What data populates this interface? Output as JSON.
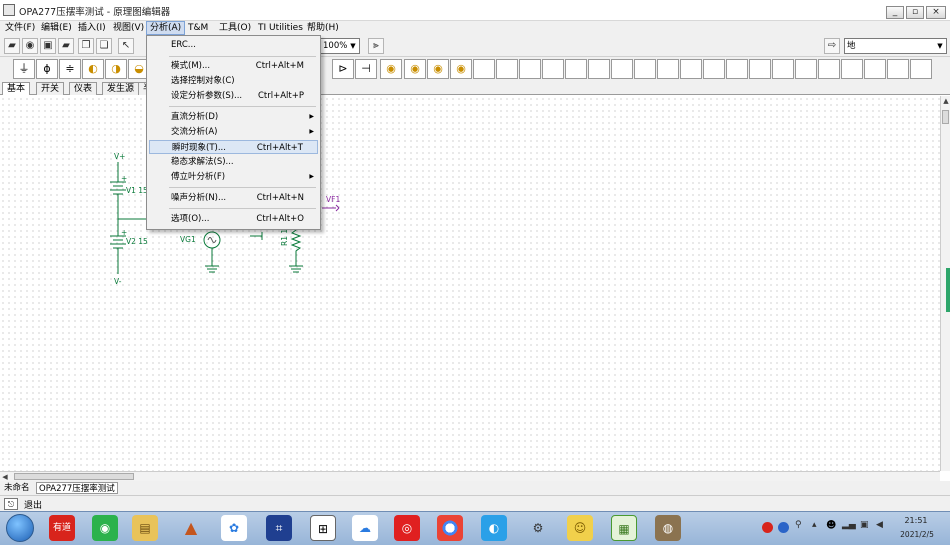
{
  "window": {
    "title": "OPA277压摆率测试 - 原理图编辑器",
    "controls": [
      "_",
      "▫",
      "×"
    ]
  },
  "menubar": [
    "文件(F)",
    "编辑(E)",
    "插入(I)",
    "视图(V)",
    "分析(A)",
    "T&M",
    "工具(O)",
    "TI Utilities",
    "帮助(H)"
  ],
  "toolbar": {
    "zoom": "100%",
    "component_search": "地"
  },
  "palette_tabs": [
    "基本",
    "开关",
    "仪表",
    "发生源",
    "半"
  ],
  "analysis_menu": {
    "erc": "ERC...",
    "mode": "模式(M)...",
    "mode_sc": "Ctrl+Alt+M",
    "select_ctrl": "选择控制对象(C)",
    "set_params": "设定分析参数(S)...",
    "set_params_sc": "Ctrl+Alt+P",
    "dc": "直流分析(D)",
    "ac": "交流分析(A)",
    "transient": "瞬时现象(T)...",
    "transient_sc": "Ctrl+Alt+T",
    "steady": "稳态求解法(S)...",
    "fourier": "傅立叶分析(F)",
    "noise": "噪声分析(N)...",
    "noise_sc": "Ctrl+Alt+N",
    "options": "选项(O)...",
    "options_sc": "Ctrl+Alt+O"
  },
  "circuit": {
    "vplus": "V+",
    "vminus": "V-",
    "v1": "V1 15",
    "v2": "V2 15",
    "vg1": "VG1",
    "vf1": "VF1",
    "r1": "R1 10",
    "plus_sign": "+"
  },
  "doc_tabs": [
    "未命名",
    "OPA277压摆率测试"
  ],
  "status": {
    "exit": "退出"
  },
  "taskbar": {
    "youdao": "有道",
    "time": "21:51",
    "date": "2021/2/5"
  }
}
